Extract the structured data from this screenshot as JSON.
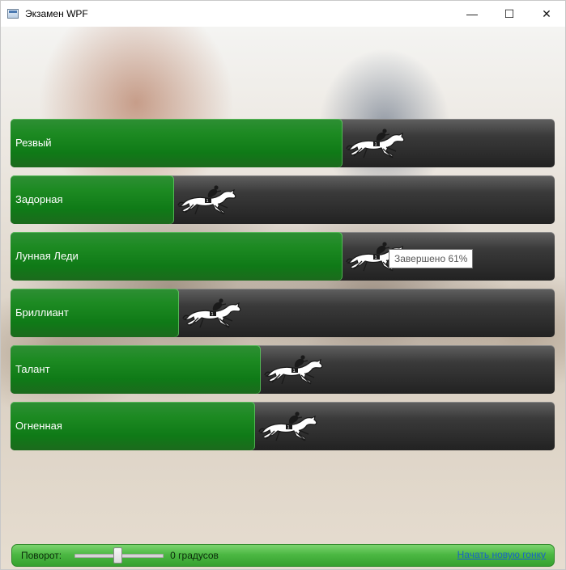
{
  "window": {
    "title": "Экзамен WPF",
    "minimize_glyph": "—",
    "maximize_glyph": "☐",
    "close_glyph": "✕"
  },
  "horses": [
    {
      "name": "Резвый",
      "progress_pct": 61
    },
    {
      "name": "Задорная",
      "progress_pct": 30
    },
    {
      "name": "Лунная Леди",
      "progress_pct": 61
    },
    {
      "name": "Бриллиант",
      "progress_pct": 31
    },
    {
      "name": "Талант",
      "progress_pct": 46
    },
    {
      "name": "Огненная",
      "progress_pct": 45
    }
  ],
  "tooltip": {
    "text": "Завершено 61%"
  },
  "statusbar": {
    "rotation_label": "Поворот:",
    "slider_value_pct": 48,
    "degrees_text": "0 градусов",
    "new_race_link": "Начать новую гонку"
  },
  "colors": {
    "progress_green": "#138a1b",
    "track_dark": "#2a2a2a",
    "statusbar_green": "#4cb843",
    "link_blue": "#1a63c9"
  },
  "icons": {
    "horse": "racehorse-with-jockey-icon",
    "app": "wpf-window-icon"
  }
}
